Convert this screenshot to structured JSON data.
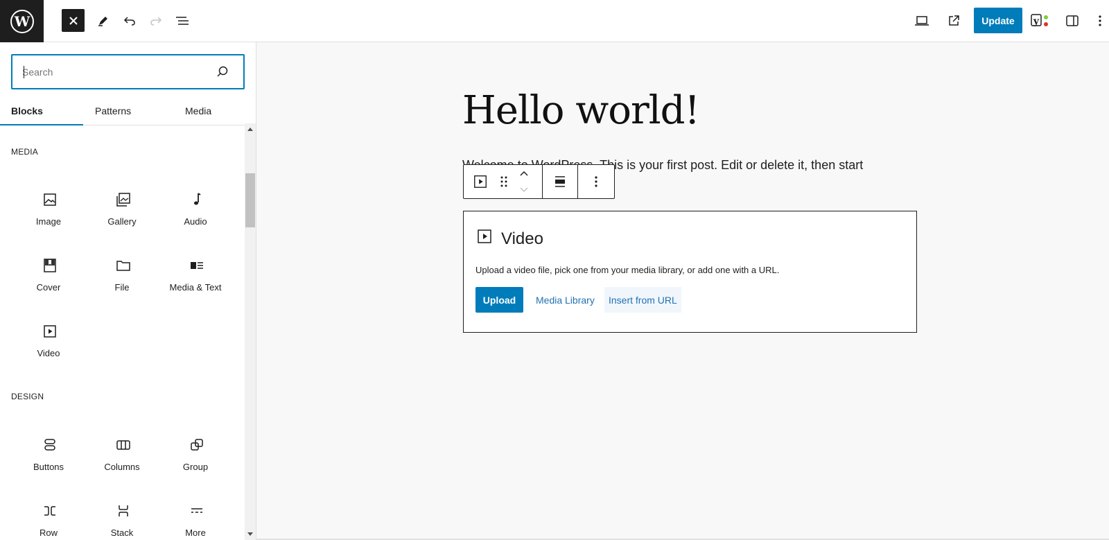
{
  "topbar": {
    "wp_logo_icon": "wordpress-logo",
    "close_icon": "close-icon",
    "tools_icon": "pencil-icon",
    "undo_icon": "undo-icon",
    "redo_icon": "redo-icon",
    "outline_icon": "document-overview-icon",
    "preview_icon": "laptop-icon",
    "view_post_icon": "external-link-icon",
    "update_label": "Update",
    "yoast_icon": "yoast-icon",
    "settings_icon": "sidebar-toggle-icon",
    "options_icon": "more-vertical-icon"
  },
  "sidebar": {
    "search": {
      "placeholder": "Search",
      "value": ""
    },
    "tabs": [
      {
        "label": "Blocks",
        "active": true
      },
      {
        "label": "Patterns",
        "active": false
      },
      {
        "label": "Media",
        "active": false
      }
    ],
    "categories": [
      {
        "label": "MEDIA",
        "blocks": [
          {
            "label": "Image",
            "icon": "image-icon"
          },
          {
            "label": "Gallery",
            "icon": "gallery-icon"
          },
          {
            "label": "Audio",
            "icon": "audio-icon"
          },
          {
            "label": "Cover",
            "icon": "cover-icon"
          },
          {
            "label": "File",
            "icon": "file-icon"
          },
          {
            "label": "Media & Text",
            "icon": "media-text-icon"
          },
          {
            "label": "Video",
            "icon": "video-icon"
          }
        ]
      },
      {
        "label": "DESIGN",
        "blocks": [
          {
            "label": "Buttons",
            "icon": "buttons-icon"
          },
          {
            "label": "Columns",
            "icon": "columns-icon"
          },
          {
            "label": "Group",
            "icon": "group-icon"
          },
          {
            "label": "Row",
            "icon": "row-icon"
          },
          {
            "label": "Stack",
            "icon": "stack-icon"
          },
          {
            "label": "More",
            "icon": "more-icon"
          }
        ]
      }
    ]
  },
  "canvas": {
    "title": "Hello world!",
    "paragraph": "Welcome to WordPress. This is your first post. Edit or delete it, then start",
    "video_block": {
      "title": "Video",
      "description": "Upload a video file, pick one from your media library, or add one with a URL.",
      "upload_label": "Upload",
      "media_library_label": "Media Library",
      "insert_url_label": "Insert from URL"
    }
  },
  "colors": {
    "accent": "#007cba",
    "link": "#2271b1",
    "dark": "#1e1e1e",
    "canvas_bg": "#f8f8f8"
  }
}
